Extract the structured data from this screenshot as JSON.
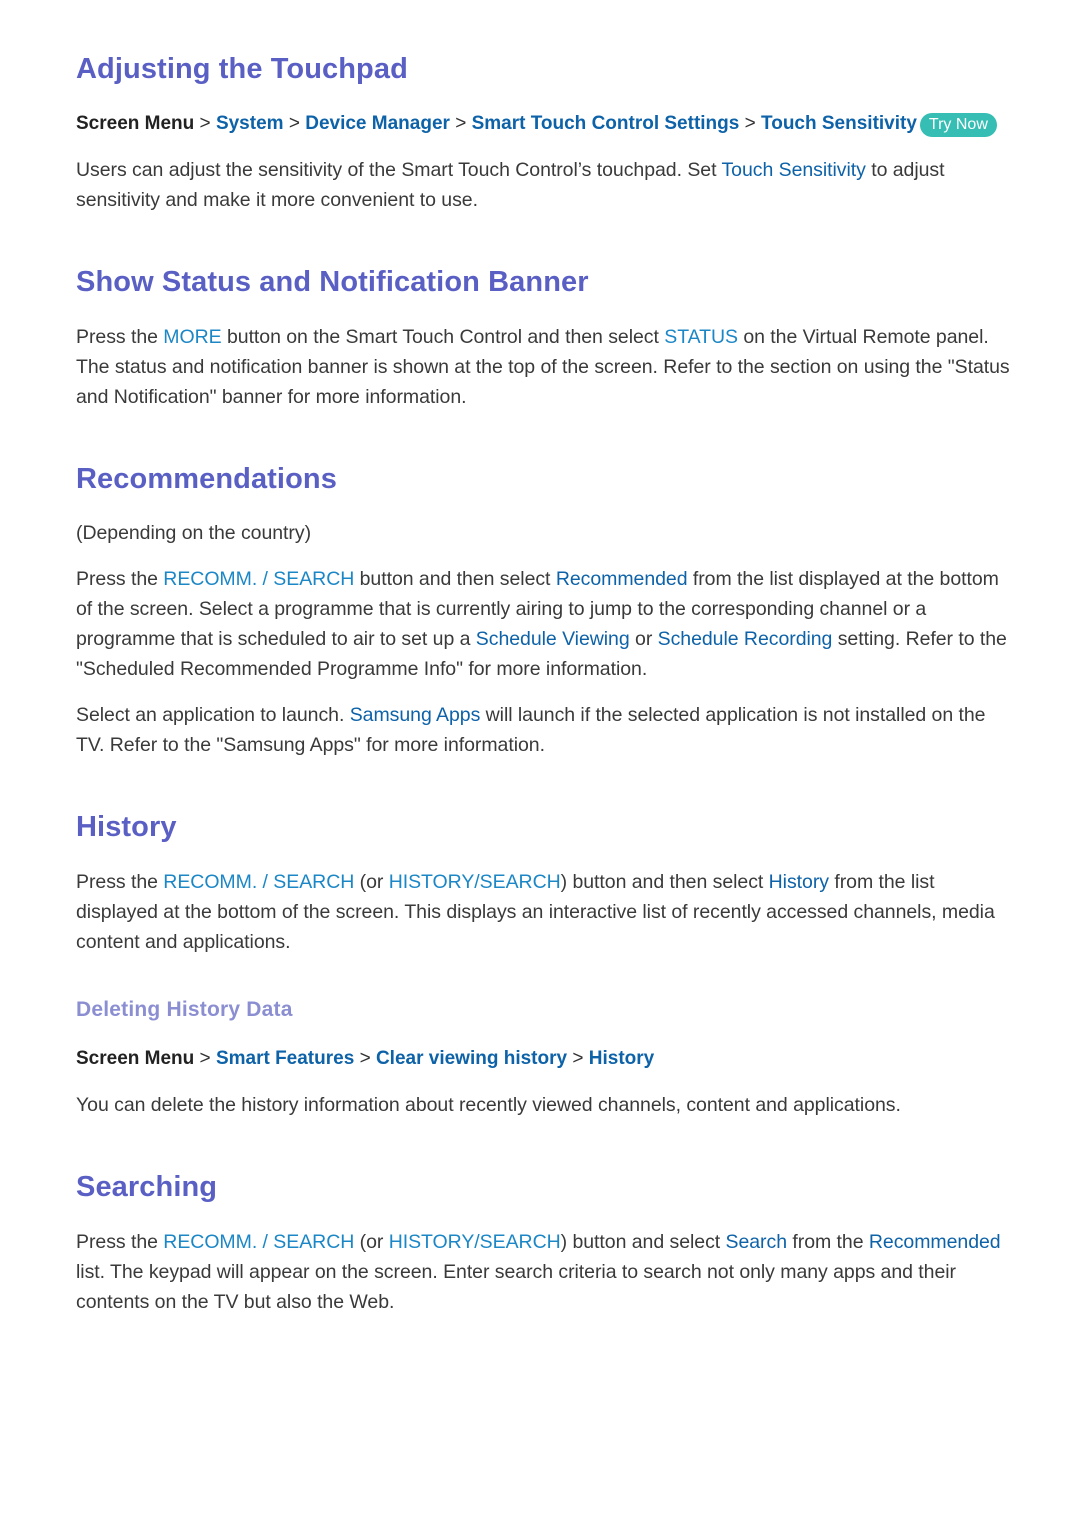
{
  "colors": {
    "heading": "#5a5fc4",
    "subheading": "#8b8fd2",
    "link_dark": "#0d62a8",
    "link_light": "#1c87c6",
    "badge": "#36beb4",
    "body_text": "#3a3a3a"
  },
  "sections": {
    "touchpad": {
      "title": "Adjusting the Touchpad",
      "breadcrumb": {
        "root": "Screen Menu",
        "sep": ">",
        "items": [
          "System",
          "Device Manager",
          "Smart Touch Control Settings",
          "Touch Sensitivity"
        ],
        "badge": "Try Now"
      },
      "paragraph": {
        "part1": "Users can adjust the sensitivity of the Smart Touch Control’s touchpad. Set ",
        "link1": "Touch Sensitivity",
        "part2": " to adjust sensitivity and make it more convenient to use."
      }
    },
    "status_banner": {
      "title": "Show Status and Notification Banner",
      "paragraph": {
        "part1": "Press the ",
        "link1": "MORE",
        "part2": " button on the Smart Touch Control and then select ",
        "link2": "STATUS",
        "part3": " on the Virtual Remote panel. The status and notification banner is shown at the top of the screen. Refer to the section on using the \"Status and Notification\" banner for more information."
      }
    },
    "recommendations": {
      "title": "Recommendations",
      "note": "(Depending on the country)",
      "paragraph1": {
        "part1": "Press the ",
        "link1": "RECOMM. / SEARCH",
        "part2": " button and then select ",
        "link2": "Recommended",
        "part3": " from the list displayed at the bottom of the screen. Select a programme that is currently airing to jump to the corresponding channel or a programme that is scheduled to air to set up a ",
        "link3": "Schedule Viewing",
        "part4": " or ",
        "link4": "Schedule Recording",
        "part5": " setting. Refer to the \"Scheduled Recommended Programme Info\" for more information."
      },
      "paragraph2": {
        "part1": "Select an application to launch. ",
        "link1": "Samsung Apps",
        "part2": " will launch if the selected application is not installed on the TV. Refer to the \"Samsung Apps\" for more information."
      }
    },
    "history": {
      "title": "History",
      "paragraph": {
        "part1": "Press the ",
        "link1": "RECOMM. / SEARCH",
        "part2": " (or ",
        "link2": "HISTORY/SEARCH",
        "part3": ") button and then select ",
        "link3": "History",
        "part4": " from the list displayed at the bottom of the screen. This displays an interactive list of recently accessed channels, media content and applications."
      },
      "subsection": {
        "title": "Deleting History Data",
        "breadcrumb": {
          "root": "Screen Menu",
          "sep": ">",
          "items": [
            "Smart Features",
            "Clear viewing history",
            "History"
          ]
        },
        "paragraph": "You can delete the history information about recently viewed channels, content and applications."
      }
    },
    "searching": {
      "title": "Searching",
      "paragraph": {
        "part1": "Press the ",
        "link1": "RECOMM. / SEARCH",
        "part2": " (or ",
        "link2": "HISTORY/SEARCH",
        "part3": ") button and select ",
        "link3": "Search",
        "part4": " from the ",
        "link4": "Recommended",
        "part5": " list. The keypad will appear on the screen. Enter search criteria to search not only many apps and their contents on the TV but also the Web."
      }
    }
  }
}
